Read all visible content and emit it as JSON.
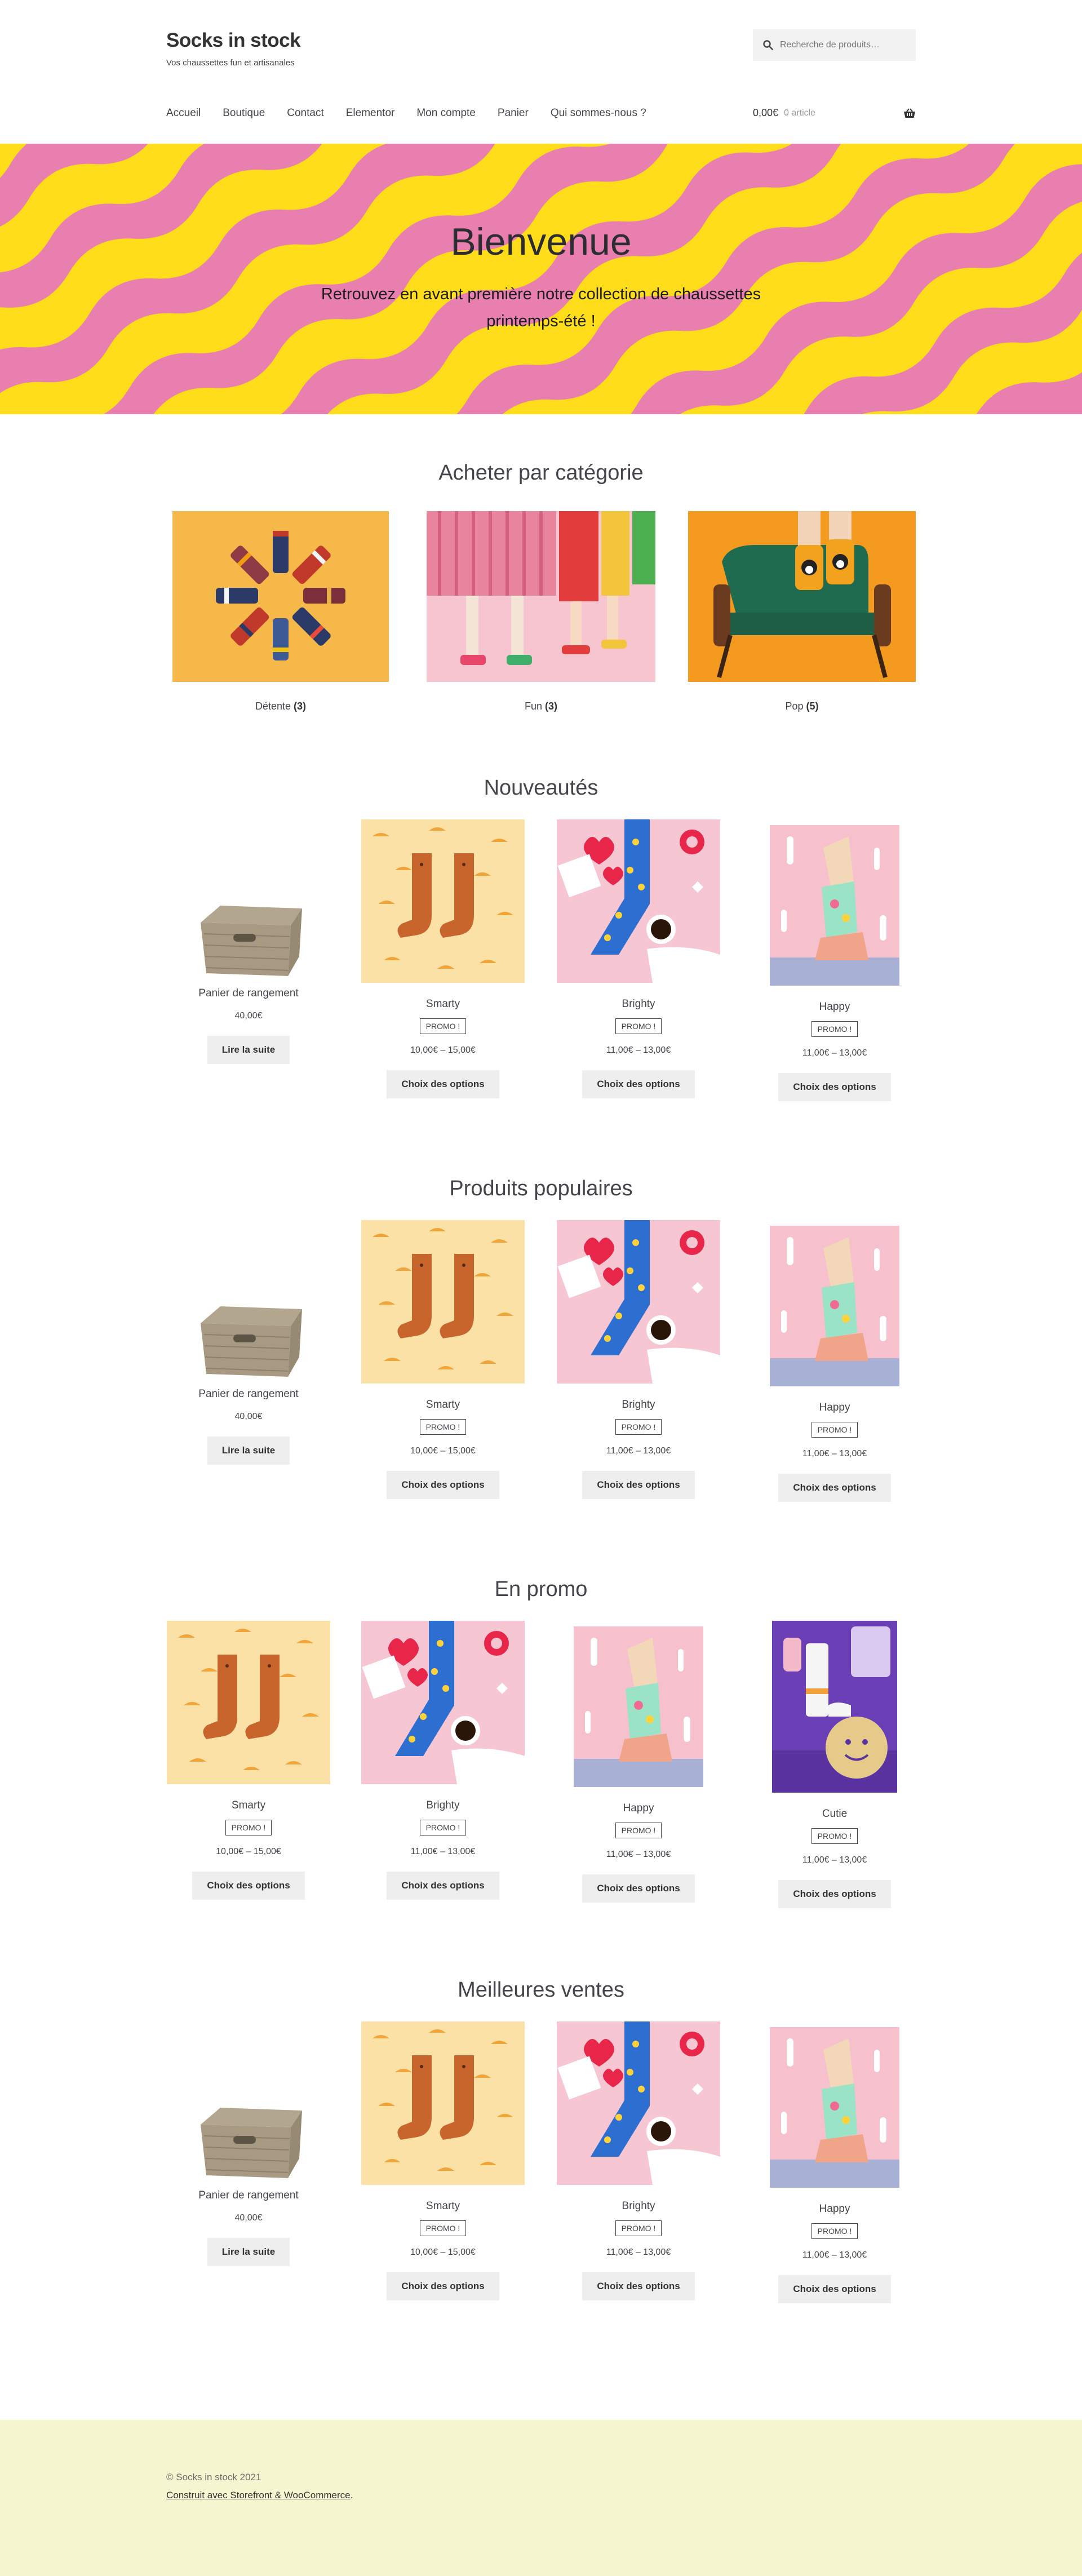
{
  "header": {
    "site_title": "Socks in stock",
    "site_description": "Vos chaussettes fun et artisanales",
    "search_placeholder": "Recherche de produits…",
    "nav": [
      "Accueil",
      "Boutique",
      "Contact",
      "Elementor",
      "Mon compte",
      "Panier",
      "Qui sommes-nous ?"
    ],
    "cart_amount": "0,00€",
    "cart_count": "0 article"
  },
  "hero": {
    "title": "Bienvenue",
    "subtitle": "Retrouvez en avant première notre collection de chaussettes printemps-été !"
  },
  "categories": {
    "title": "Acheter par catégorie",
    "items": [
      {
        "name": "Détente",
        "count": "(3)"
      },
      {
        "name": "Fun",
        "count": "(3)"
      },
      {
        "name": "Pop",
        "count": "(5)"
      }
    ]
  },
  "sections": [
    {
      "title": "Nouveautés",
      "products": [
        {
          "name": "Panier de rangement",
          "promo": "",
          "price": "40,00€",
          "button": "Lire la suite",
          "image": "basket"
        },
        {
          "name": "Smarty",
          "promo": "PROMO !",
          "price": "10,00€ – 15,00€",
          "button": "Choix des options",
          "image": "smarty"
        },
        {
          "name": "Brighty",
          "promo": "PROMO !",
          "price": "11,00€ – 13,00€",
          "button": "Choix des options",
          "image": "brighty"
        },
        {
          "name": "Happy",
          "promo": "PROMO !",
          "price": "11,00€ – 13,00€",
          "button": "Choix des options",
          "image": "happy"
        }
      ]
    },
    {
      "title": "Produits populaires",
      "products": [
        {
          "name": "Panier de rangement",
          "promo": "",
          "price": "40,00€",
          "button": "Lire la suite",
          "image": "basket"
        },
        {
          "name": "Smarty",
          "promo": "PROMO !",
          "price": "10,00€ – 15,00€",
          "button": "Choix des options",
          "image": "smarty"
        },
        {
          "name": "Brighty",
          "promo": "PROMO !",
          "price": "11,00€ – 13,00€",
          "button": "Choix des options",
          "image": "brighty"
        },
        {
          "name": "Happy",
          "promo": "PROMO !",
          "price": "11,00€ – 13,00€",
          "button": "Choix des options",
          "image": "happy"
        }
      ]
    },
    {
      "title": "En promo",
      "products": [
        {
          "name": "Smarty",
          "promo": "PROMO !",
          "price": "10,00€ – 15,00€",
          "button": "Choix des options",
          "image": "smarty"
        },
        {
          "name": "Brighty",
          "promo": "PROMO !",
          "price": "11,00€ – 13,00€",
          "button": "Choix des options",
          "image": "brighty"
        },
        {
          "name": "Happy",
          "promo": "PROMO !",
          "price": "11,00€ – 13,00€",
          "button": "Choix des options",
          "image": "happy"
        },
        {
          "name": "Cutie",
          "promo": "PROMO !",
          "price": "11,00€ – 13,00€",
          "button": "Choix des options",
          "image": "cutie"
        }
      ]
    },
    {
      "title": "Meilleures ventes",
      "products": [
        {
          "name": "Panier de rangement",
          "promo": "",
          "price": "40,00€",
          "button": "Lire la suite",
          "image": "basket"
        },
        {
          "name": "Smarty",
          "promo": "PROMO !",
          "price": "10,00€ – 15,00€",
          "button": "Choix des options",
          "image": "smarty"
        },
        {
          "name": "Brighty",
          "promo": "PROMO !",
          "price": "11,00€ – 13,00€",
          "button": "Choix des options",
          "image": "brighty"
        },
        {
          "name": "Happy",
          "promo": "PROMO !",
          "price": "11,00€ – 13,00€",
          "button": "Choix des options",
          "image": "happy"
        }
      ]
    }
  ],
  "footer": {
    "copyright": "© Socks in stock 2021",
    "credit": "Construit avec Storefront & WooCommerce",
    "credit_suffix": "."
  },
  "colors": {
    "hero_yellow": "#ffdd1a",
    "hero_pink": "#e97fae",
    "footer_bg": "#f5f5cf",
    "button_bg": "#eeeeee"
  }
}
